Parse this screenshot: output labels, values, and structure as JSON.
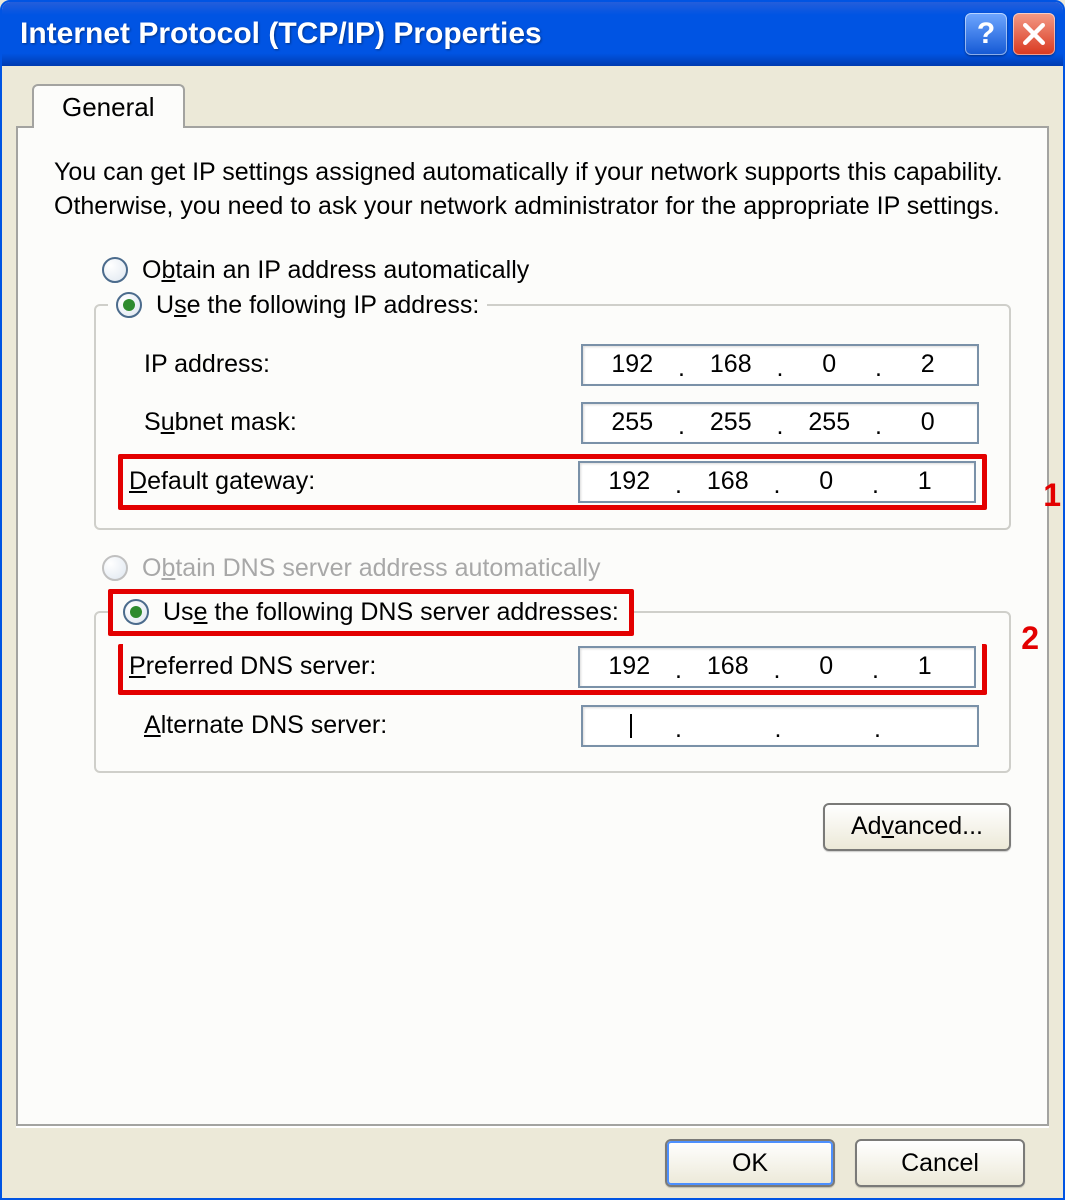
{
  "window": {
    "title": "Internet Protocol (TCP/IP) Properties"
  },
  "tab": {
    "general": "General"
  },
  "intro": "You can get IP settings assigned automatically if your network supports this capability. Otherwise, you need to ask your network administrator for the appropriate IP settings.",
  "ip": {
    "auto_label_pre": "O",
    "auto_label_u": "b",
    "auto_label_post": "tain an IP address automatically",
    "manual_label_pre": "U",
    "manual_label_u": "s",
    "manual_label_post": "e the following IP address:",
    "addr_label": "IP address:",
    "mask_label_pre": "S",
    "mask_label_u": "u",
    "mask_label_post": "bnet mask:",
    "gw_label_pre": "",
    "gw_label_u": "D",
    "gw_label_post": "efault gateway:",
    "addr": {
      "o1": "192",
      "o2": "168",
      "o3": "0",
      "o4": "2"
    },
    "mask": {
      "o1": "255",
      "o2": "255",
      "o3": "255",
      "o4": "0"
    },
    "gw": {
      "o1": "192",
      "o2": "168",
      "o3": "0",
      "o4": "1"
    }
  },
  "dns": {
    "auto_label_pre": "O",
    "auto_label_u": "b",
    "auto_label_post": "tain DNS server address automatically",
    "manual_label_pre": "Us",
    "manual_label_u": "e",
    "manual_label_post": " the following DNS server addresses:",
    "pref_label_pre": "",
    "pref_label_u": "P",
    "pref_label_post": "referred DNS server:",
    "alt_label_pre": "",
    "alt_label_u": "A",
    "alt_label_post": "lternate DNS server:",
    "pref": {
      "o1": "192",
      "o2": "168",
      "o3": "0",
      "o4": "1"
    },
    "alt": {
      "o1": "",
      "o2": "",
      "o3": "",
      "o4": ""
    }
  },
  "annotations": {
    "n1": "1",
    "n2": "2"
  },
  "buttons": {
    "advanced_pre": "Ad",
    "advanced_u": "v",
    "advanced_post": "anced...",
    "ok": "OK",
    "cancel": "Cancel"
  },
  "help": "?",
  "accent_red": "#e30000"
}
